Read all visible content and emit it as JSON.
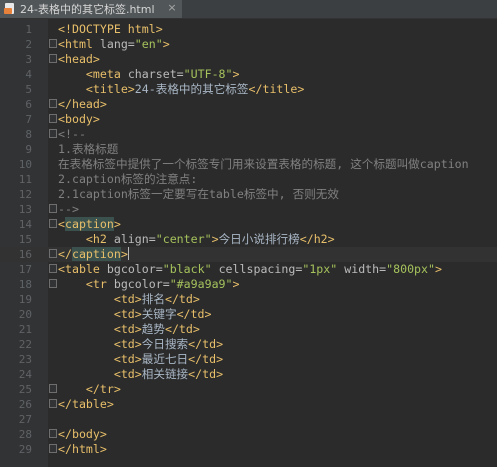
{
  "tab": {
    "title": "24-表格中的其它标签.html",
    "close": "×"
  },
  "lines": [
    {
      "n": "1",
      "seg": [
        {
          "c": "t",
          "v": "<!DOCTYPE html>"
        }
      ]
    },
    {
      "n": "2",
      "seg": [
        {
          "c": "t",
          "v": "<html "
        },
        {
          "c": "a",
          "v": "lang="
        },
        {
          "c": "s",
          "v": "\"en\""
        },
        {
          "c": "t",
          "v": ">"
        }
      ]
    },
    {
      "n": "3",
      "seg": [
        {
          "c": "t",
          "v": "<head>"
        }
      ]
    },
    {
      "n": "4",
      "seg": [
        {
          "c": "x",
          "v": "    "
        },
        {
          "c": "t",
          "v": "<meta "
        },
        {
          "c": "a",
          "v": "charset="
        },
        {
          "c": "s",
          "v": "\"UTF-8\""
        },
        {
          "c": "t",
          "v": ">"
        }
      ]
    },
    {
      "n": "5",
      "seg": [
        {
          "c": "x",
          "v": "    "
        },
        {
          "c": "t",
          "v": "<title>"
        },
        {
          "c": "x",
          "v": "24-表格中的其它标签"
        },
        {
          "c": "t",
          "v": "</title>"
        }
      ]
    },
    {
      "n": "6",
      "seg": [
        {
          "c": "t",
          "v": "</head>"
        }
      ]
    },
    {
      "n": "7",
      "seg": [
        {
          "c": "t",
          "v": "<body>"
        }
      ]
    },
    {
      "n": "8",
      "seg": [
        {
          "c": "c",
          "v": "<!--"
        }
      ]
    },
    {
      "n": "9",
      "seg": [
        {
          "c": "c",
          "v": "1.表格标题"
        }
      ]
    },
    {
      "n": "10",
      "seg": [
        {
          "c": "c",
          "v": "在表格标签中提供了一个标签专门用来设置表格的标题, 这个标题叫做caption"
        }
      ]
    },
    {
      "n": "11",
      "seg": [
        {
          "c": "c",
          "v": "2.caption标签的注意点:"
        }
      ]
    },
    {
      "n": "12",
      "seg": [
        {
          "c": "c",
          "v": "2.1caption标签一定要写在table标签中, 否则无效"
        }
      ]
    },
    {
      "n": "13",
      "seg": [
        {
          "c": "c",
          "v": "-->"
        }
      ]
    },
    {
      "n": "14",
      "seg": [
        {
          "c": "t",
          "v": "<"
        },
        {
          "c": "th",
          "v": "caption"
        },
        {
          "c": "t",
          "v": ">"
        }
      ]
    },
    {
      "n": "15",
      "seg": [
        {
          "c": "x",
          "v": "    "
        },
        {
          "c": "t",
          "v": "<h2 "
        },
        {
          "c": "a",
          "v": "align="
        },
        {
          "c": "s",
          "v": "\"center\""
        },
        {
          "c": "t",
          "v": ">"
        },
        {
          "c": "x",
          "v": "今日小说排行榜"
        },
        {
          "c": "t",
          "v": "</h2>"
        }
      ]
    },
    {
      "n": "16",
      "seg": [
        {
          "c": "t",
          "v": "</"
        },
        {
          "c": "th",
          "v": "caption"
        },
        {
          "c": "t",
          "v": ">"
        }
      ]
    },
    {
      "n": "17",
      "seg": [
        {
          "c": "t",
          "v": "<table "
        },
        {
          "c": "a",
          "v": "bgcolor="
        },
        {
          "c": "s",
          "v": "\"black\""
        },
        {
          "c": "a",
          "v": " cellspacing="
        },
        {
          "c": "s",
          "v": "\"1px\""
        },
        {
          "c": "a",
          "v": " width="
        },
        {
          "c": "s",
          "v": "\"800px\""
        },
        {
          "c": "t",
          "v": ">"
        }
      ]
    },
    {
      "n": "18",
      "seg": [
        {
          "c": "x",
          "v": "    "
        },
        {
          "c": "t",
          "v": "<tr "
        },
        {
          "c": "a",
          "v": "bgcolor="
        },
        {
          "c": "s",
          "v": "\"#a9a9a9\""
        },
        {
          "c": "t",
          "v": ">"
        }
      ]
    },
    {
      "n": "19",
      "seg": [
        {
          "c": "x",
          "v": "        "
        },
        {
          "c": "t",
          "v": "<td>"
        },
        {
          "c": "x",
          "v": "排名"
        },
        {
          "c": "t",
          "v": "</td>"
        }
      ]
    },
    {
      "n": "20",
      "seg": [
        {
          "c": "x",
          "v": "        "
        },
        {
          "c": "t",
          "v": "<td>"
        },
        {
          "c": "x",
          "v": "关键字"
        },
        {
          "c": "t",
          "v": "</td>"
        }
      ]
    },
    {
      "n": "21",
      "seg": [
        {
          "c": "x",
          "v": "        "
        },
        {
          "c": "t",
          "v": "<td>"
        },
        {
          "c": "x",
          "v": "趋势"
        },
        {
          "c": "t",
          "v": "</td>"
        }
      ]
    },
    {
      "n": "22",
      "seg": [
        {
          "c": "x",
          "v": "        "
        },
        {
          "c": "t",
          "v": "<td>"
        },
        {
          "c": "x",
          "v": "今日搜索"
        },
        {
          "c": "t",
          "v": "</td>"
        }
      ]
    },
    {
      "n": "23",
      "seg": [
        {
          "c": "x",
          "v": "        "
        },
        {
          "c": "t",
          "v": "<td>"
        },
        {
          "c": "x",
          "v": "最近七日"
        },
        {
          "c": "t",
          "v": "</td>"
        }
      ]
    },
    {
      "n": "24",
      "seg": [
        {
          "c": "x",
          "v": "        "
        },
        {
          "c": "t",
          "v": "<td>"
        },
        {
          "c": "x",
          "v": "相关链接"
        },
        {
          "c": "t",
          "v": "</td>"
        }
      ]
    },
    {
      "n": "25",
      "seg": [
        {
          "c": "x",
          "v": "    "
        },
        {
          "c": "t",
          "v": "</tr>"
        }
      ]
    },
    {
      "n": "26",
      "seg": [
        {
          "c": "t",
          "v": "</table>"
        }
      ]
    },
    {
      "n": "27",
      "seg": []
    },
    {
      "n": "28",
      "seg": [
        {
          "c": "t",
          "v": "</body>"
        }
      ]
    },
    {
      "n": "29",
      "seg": [
        {
          "c": "t",
          "v": "</html>"
        }
      ]
    }
  ],
  "current_line": "16",
  "fold_lines": [
    "2",
    "3",
    "6",
    "7",
    "8",
    "13",
    "14",
    "16",
    "17",
    "18",
    "25",
    "26",
    "28",
    "29"
  ],
  "colors": {
    "background": "#2b2b2b",
    "tag": "#e8bf6a",
    "attribute": "#bababa",
    "string": "#a5c25c",
    "comment": "#808080",
    "text": "#a9b7c6",
    "line_number": "#606366",
    "tag_match_highlight": "#3b514d"
  }
}
